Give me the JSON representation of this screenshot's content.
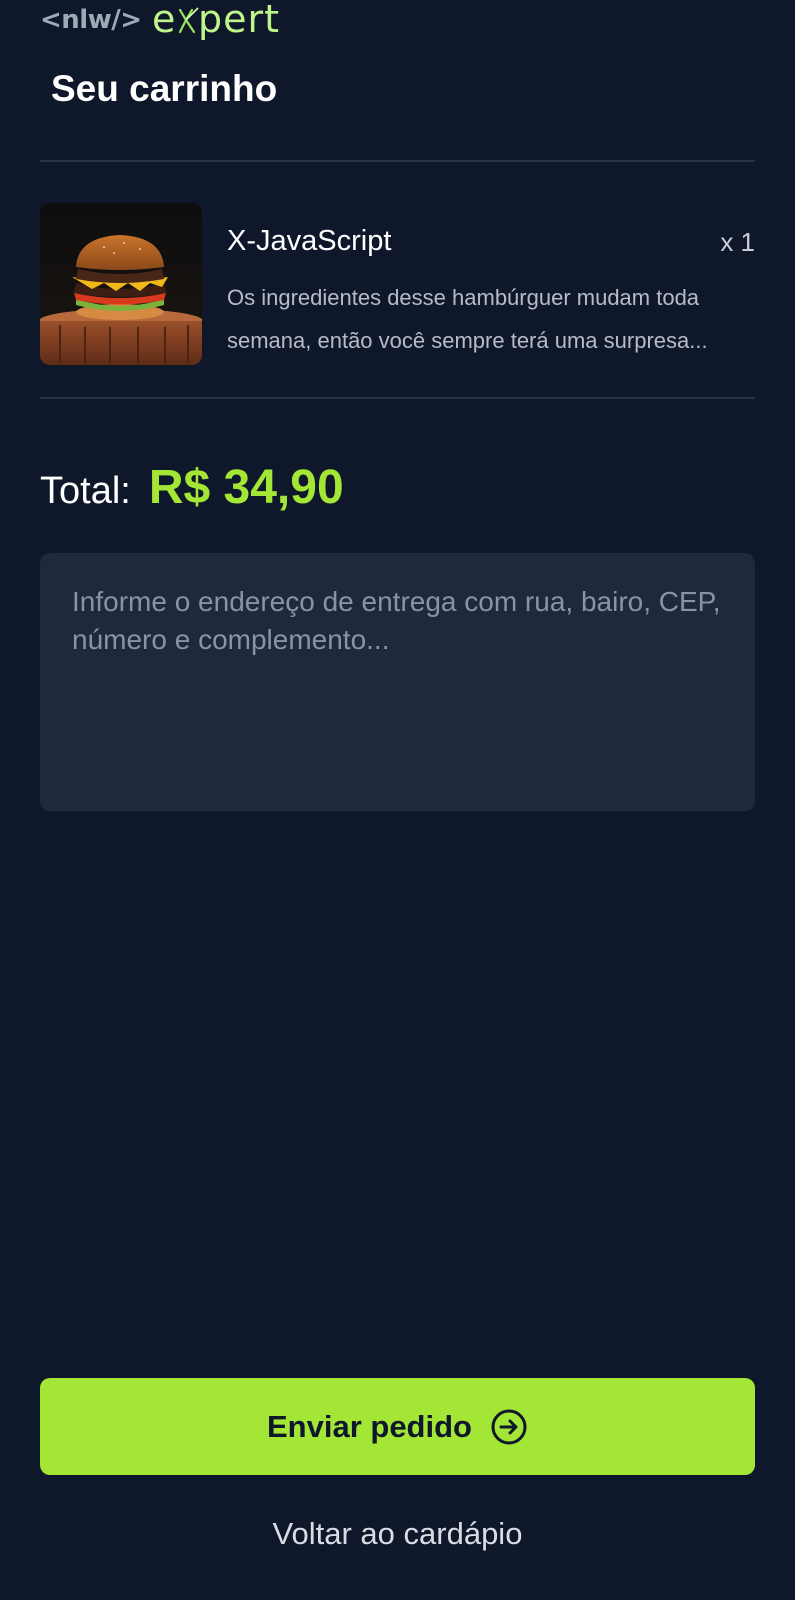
{
  "brand": {
    "nlw": "<nlw/>",
    "expert": "expert",
    "accent_color": "#a3e635"
  },
  "page": {
    "title": "Seu carrinho"
  },
  "cart": {
    "items": [
      {
        "name": "X-JavaScript",
        "quantity": "x 1",
        "description": "Os ingredientes desse hambúrguer mudam toda\nsemana, então você sempre terá uma surpresa...",
        "image": "burger-image"
      }
    ]
  },
  "total": {
    "label": "Total:",
    "value": "R$ 34,90"
  },
  "address": {
    "placeholder": "Informe o endereço de entrega com rua, bairo, CEP, número e complemento...",
    "value": ""
  },
  "actions": {
    "send_label": "Enviar pedido",
    "send_icon": "arrow-circle-right-icon",
    "back_label": "Voltar ao cardápio"
  },
  "colors": {
    "background": "#0f172a",
    "input_background": "#1e293b",
    "divider": "#273247"
  }
}
